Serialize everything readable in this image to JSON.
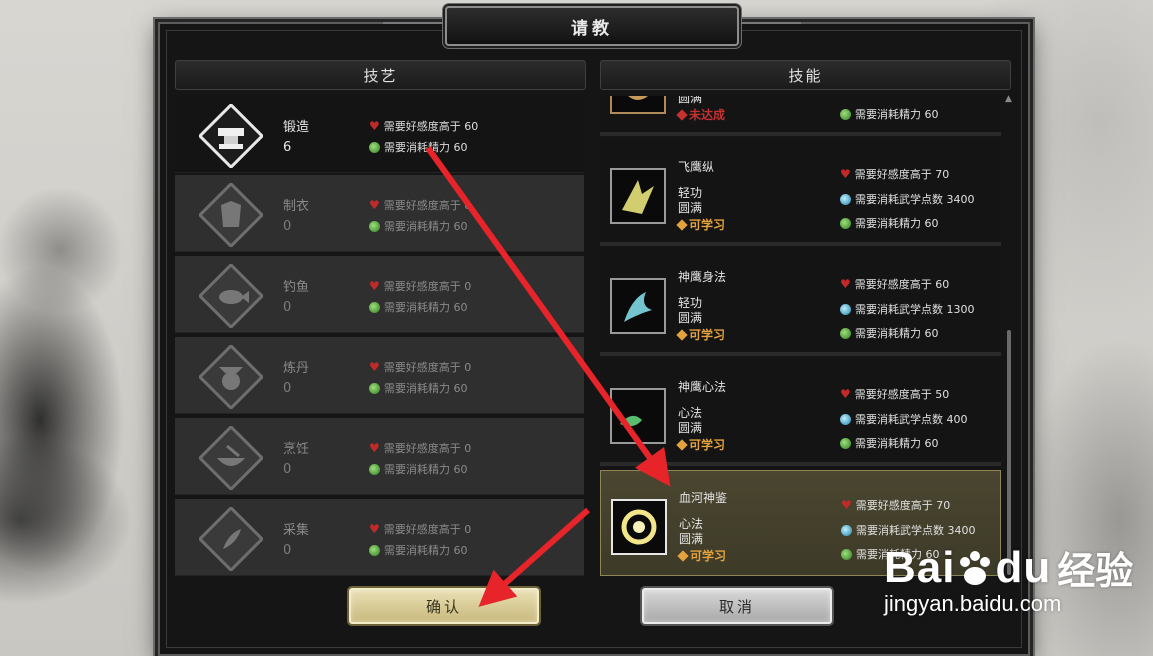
{
  "dialog": {
    "title": "请教"
  },
  "left_column": {
    "header": "技艺",
    "items": [
      {
        "name": "锻造",
        "level": "6",
        "req_favor": "需要好感度高于 60",
        "req_stamina": "需要消耗精力 60",
        "icon": "anvil-icon",
        "active": true
      },
      {
        "name": "制衣",
        "level": "0",
        "req_favor": "需要好感度高于 0",
        "req_stamina": "需要消耗精力 60",
        "icon": "robe-icon",
        "active": false
      },
      {
        "name": "钓鱼",
        "level": "0",
        "req_favor": "需要好感度高于 0",
        "req_stamina": "需要消耗精力 60",
        "icon": "fish-icon",
        "active": false
      },
      {
        "name": "炼丹",
        "level": "0",
        "req_favor": "需要好感度高于 0",
        "req_stamina": "需要消耗精力 60",
        "icon": "cauldron-icon",
        "active": false
      },
      {
        "name": "烹饪",
        "level": "0",
        "req_favor": "需要好感度高于 0",
        "req_stamina": "需要消耗精力 60",
        "icon": "cooking-bowl-icon",
        "active": false
      },
      {
        "name": "采集",
        "level": "0",
        "req_favor": "需要好感度高于 0",
        "req_stamina": "需要消耗精力 60",
        "icon": "herb-icon",
        "active": false
      }
    ]
  },
  "right_column": {
    "header": "技能",
    "partial_item": {
      "level": "圆满",
      "status": "未达成",
      "req_stamina": "需要消耗精力 60"
    },
    "items": [
      {
        "name": "飞鹰纵",
        "type": "轻功",
        "level": "圆满",
        "status": "可学习",
        "req_favor": "需要好感度高于 70",
        "req_points": "需要消耗武学点数 3400",
        "req_stamina": "需要消耗精力 60",
        "icon": "flying-eagle-icon"
      },
      {
        "name": "神鹰身法",
        "type": "轻功",
        "level": "圆满",
        "status": "可学习",
        "req_favor": "需要好感度高于 60",
        "req_points": "需要消耗武学点数 1300",
        "req_stamina": "需要消耗精力 60",
        "icon": "divine-eagle-icon"
      },
      {
        "name": "神鹰心法",
        "type": "心法",
        "level": "圆满",
        "status": "可学习",
        "req_favor": "需要好感度高于 50",
        "req_points": "需要消耗武学点数 400",
        "req_stamina": "需要消耗精力 60",
        "icon": "eagle-heart-icon"
      },
      {
        "name": "血河神鉴",
        "type": "心法",
        "level": "圆满",
        "status": "可学习",
        "req_favor": "需要好感度高于 70",
        "req_points": "需要消耗武学点数 3400",
        "req_stamina": "需要消耗精力 60",
        "icon": "blood-river-icon",
        "selected": true
      }
    ]
  },
  "buttons": {
    "confirm": "确认",
    "cancel": "取消"
  },
  "watermark": {
    "brand": "Bai",
    "brand2": "du",
    "cn": "经验",
    "url": "jingyan.baidu.com"
  },
  "colors": {
    "arrow": "#e8242b",
    "gold": "#e3a23c",
    "selected_row": "#4a4630"
  }
}
